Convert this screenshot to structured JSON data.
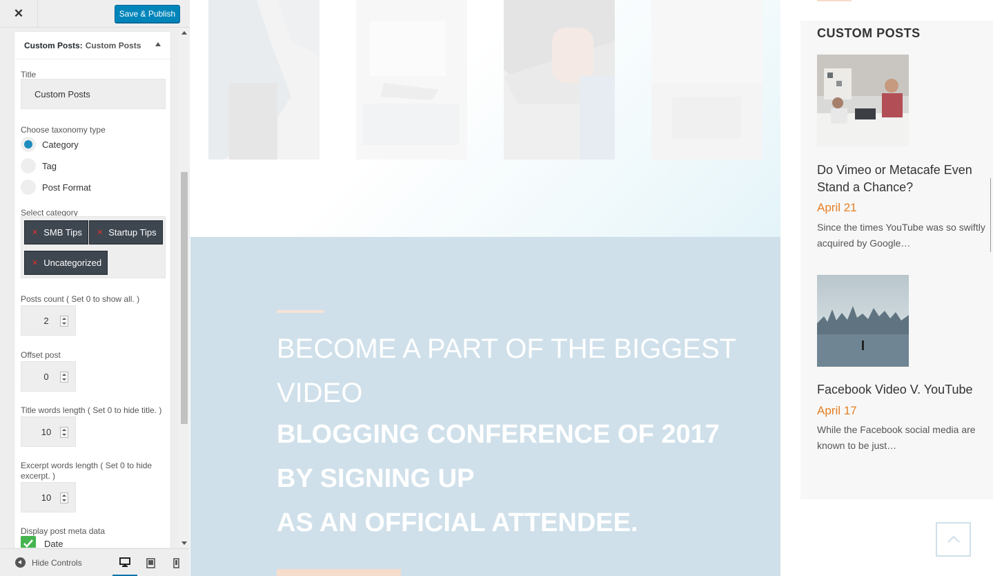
{
  "customizer": {
    "close_label": "✕",
    "save_label": "Save & Publish",
    "widget": {
      "title_prefix": "Custom Posts:",
      "title_name": "Custom Posts",
      "title_label": "Title",
      "title_value": "Custom Posts",
      "taxonomy_label": "Choose taxonomy type",
      "taxonomy_options": [
        "Category",
        "Tag",
        "Post Format"
      ],
      "taxonomy_selected": "Category",
      "category_label": "Select category",
      "categories": [
        "SMB Tips",
        "Startup Tips",
        "Uncategorized"
      ],
      "posts_count_label": "Posts count ( Set 0 to show all. )",
      "posts_count": "2",
      "offset_label": "Offset post",
      "offset": "0",
      "title_words_label": "Title words length ( Set 0 to hide title. )",
      "title_words": "10",
      "excerpt_words_label": "Excerpt words length ( Set 0 to hide excerpt. )",
      "excerpt_words": "10",
      "meta_label": "Display post meta data",
      "meta_date_label": "Date"
    },
    "footer": {
      "hide_controls_label": "Hide Controls"
    }
  },
  "preview": {
    "banner": {
      "line1": "BECOME A PART OF THE BIGGEST",
      "line2": "VIDEO",
      "bold1": "BLOGGING CONFERENCE OF 2017",
      "bold2": "BY SIGNING UP",
      "bold3": "AS AN OFFICIAL ATTENDEE."
    },
    "sidebar": {
      "title": "CUSTOM POSTS",
      "posts": [
        {
          "title": "Do Vimeo or Metacafe Even Stand a Chance?",
          "date": "April 21",
          "excerpt": "Since the times YouTube was so swiftly acquired by Google…"
        },
        {
          "title": "Facebook Video V. YouTube",
          "date": "April 17",
          "excerpt": "While the Facebook social media are known to be just…"
        }
      ]
    },
    "colors": {
      "accent": "#e67e22",
      "banner_bg": "#cfe0ea",
      "wp_blue": "#0085ba"
    }
  }
}
